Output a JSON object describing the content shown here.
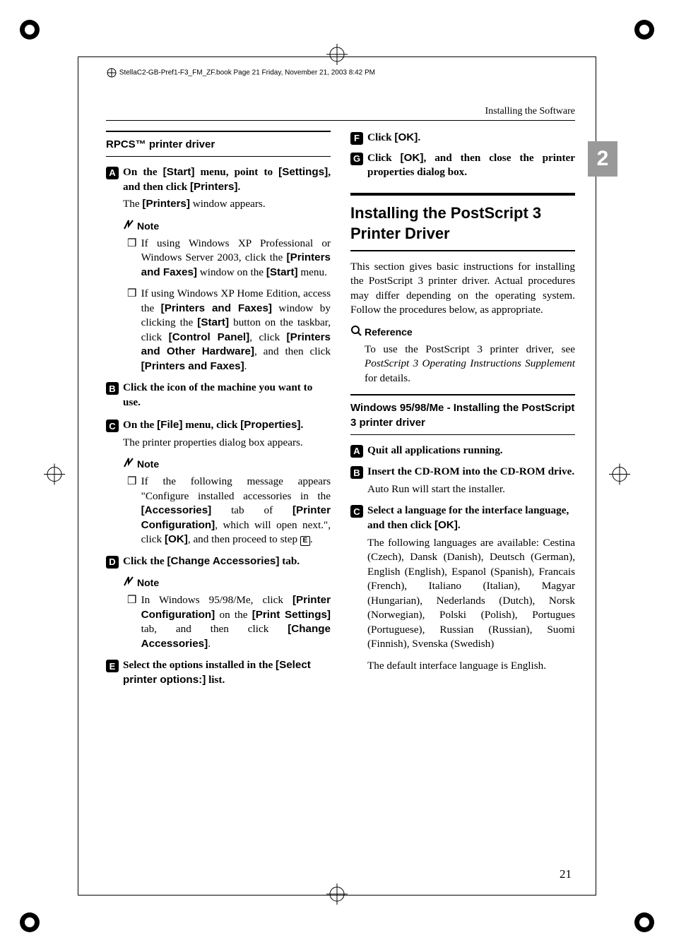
{
  "meta": {
    "runningHead": "StellaC2-GB-Pref1-F3_FM_ZF.book  Page 21  Friday, November 21, 2003  8:42 PM",
    "sectionRight": "Installing the Software",
    "sideTab": "2",
    "pageNum": "21"
  },
  "left": {
    "subhead": "RPCS™ printer driver",
    "s1": {
      "num": "A",
      "txt_a": "On the ",
      "ui1": "[Start]",
      "txt_b": " menu, point to ",
      "ui2": "[Settings]",
      "txt_c": ", and then click ",
      "ui3": "[Printers]",
      "txt_d": "."
    },
    "s1_body_a": "The ",
    "s1_body_ui": "[Printers]",
    "s1_body_b": " window appears.",
    "noteLabel": "Note",
    "n1_a": "If using Windows XP Professional or Windows Server 2003, click the ",
    "n1_ui1": "[Printers and Faxes]",
    "n1_b": " window on the ",
    "n1_ui2": "[Start]",
    "n1_c": " menu.",
    "n2_a": "If using Windows XP Home Edition, access the ",
    "n2_ui1": "[Printers and Faxes]",
    "n2_b": " window by clicking the ",
    "n2_ui2": "[Start]",
    "n2_c": " button on the taskbar, click ",
    "n2_ui3": "[Control Panel]",
    "n2_d": ", click ",
    "n2_ui4": "[Printers and Other Hardware]",
    "n2_e": ", and then click ",
    "n2_ui5": "[Printers and Faxes]",
    "n2_f": ".",
    "s2": {
      "num": "B",
      "txt": "Click the icon of the machine you want to use."
    },
    "s3": {
      "num": "C",
      "txt_a": "On the ",
      "ui1": "[File]",
      "txt_b": " menu, click ",
      "ui2": "[Properties]",
      "txt_c": "."
    },
    "s3_body": "The printer properties dialog box appears.",
    "n3_a": "If the following message appears \"Configure installed accessories in the ",
    "n3_ui1": "[Accessories]",
    "n3_b": " tab of ",
    "n3_ui2": "[Printer Configuration]",
    "n3_c": ", which will open next.\", click ",
    "n3_ui3": "[OK]",
    "n3_d": ", and then proceed to step ",
    "n3_ref": "E",
    "n3_e": ".",
    "s4": {
      "num": "D",
      "txt_a": "Click the ",
      "ui1": "[Change Accessories]",
      "txt_b": " tab."
    },
    "n4_a": "In Windows 95/98/Me, click ",
    "n4_ui1": "[Printer Configuration]",
    "n4_b": " on the ",
    "n4_ui2": "[Print Settings]",
    "n4_c": " tab, and then click ",
    "n4_ui3": "[Change Accessories]",
    "n4_d": ".",
    "s5": {
      "num": "E",
      "txt_a": "Select the options installed in the ",
      "ui1": "[Select printer options:]",
      "txt_b": " list."
    }
  },
  "right": {
    "s6": {
      "num": "F",
      "txt_a": "Click ",
      "ui1": "[OK]",
      "txt_b": "."
    },
    "s7": {
      "num": "G",
      "txt_a": "Click ",
      "ui1": "[OK]",
      "txt_b": ", and then close the printer properties dialog box."
    },
    "h2": "Installing the PostScript 3 Printer Driver",
    "intro": "This section gives basic instructions for installing the PostScript 3 printer driver. Actual procedures may differ depending on the operating system. Follow the procedures below, as appropriate.",
    "refLabel": "Reference",
    "ref_a": "To use the PostScript 3 printer driver, see ",
    "ref_i": "PostScript 3 Operating Instructions Supplement",
    "ref_b": " for details.",
    "subhead2": "Windows 95/98/Me - Installing the PostScript 3 printer driver",
    "r1": {
      "num": "A",
      "txt": "Quit all applications running."
    },
    "r2": {
      "num": "B",
      "txt": "Insert the CD-ROM into the CD-ROM drive."
    },
    "r2_body": "Auto Run will start the installer.",
    "r3": {
      "num": "C",
      "txt_a": "Select a language for the interface language, and then click ",
      "ui1": "[OK]",
      "txt_b": "."
    },
    "r3_body1": "The following languages are available: Cestina (Czech), Dansk (Danish), Deutsch (German), English (English), Espanol (Spanish), Francais (French), Italiano (Italian), Magyar (Hungarian), Nederlands (Dutch), Norsk (Norwegian), Polski (Polish), Portugues (Portuguese), Russian (Russian), Suomi (Finnish), Svenska (Swedish)",
    "r3_body2": "The default interface language is English."
  }
}
